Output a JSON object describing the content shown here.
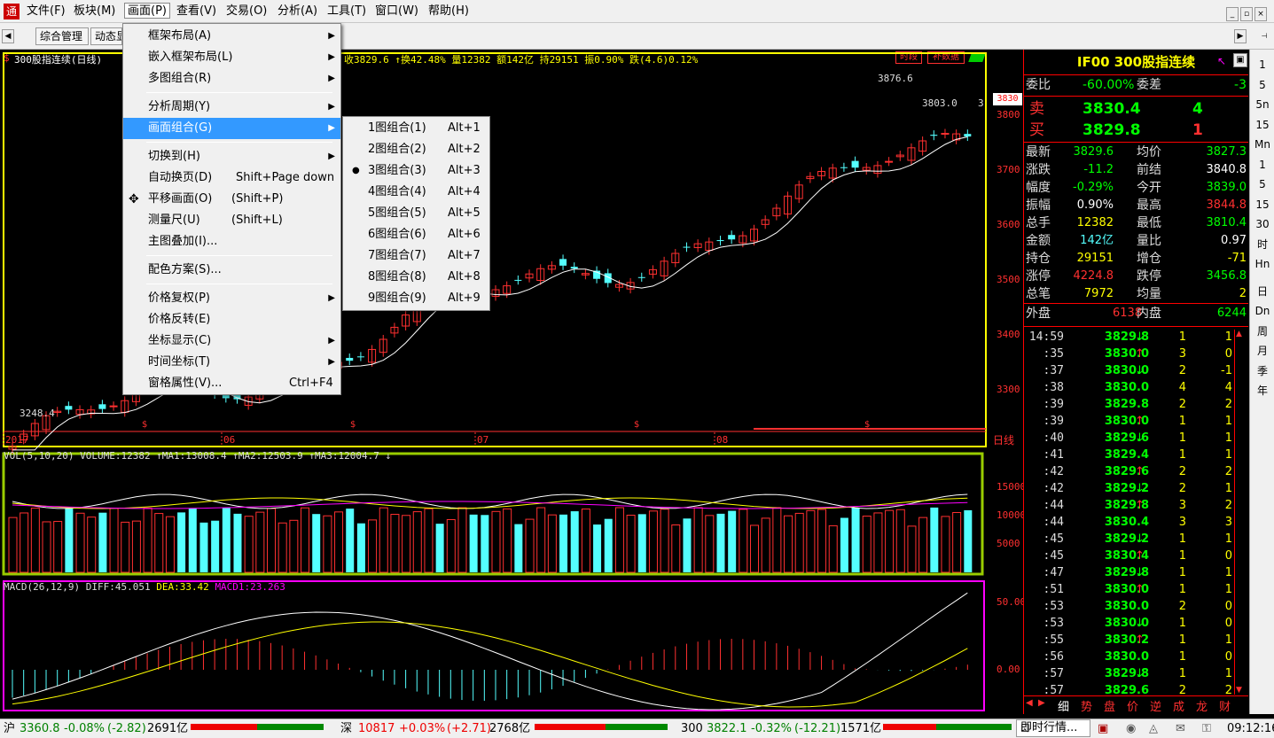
{
  "app": {
    "logo": "通",
    "colors": {
      "up": "#ff3030",
      "down": "#54ffff",
      "ma": "#ffff00",
      "bg": "#000000"
    }
  },
  "menubar": [
    "文件(F)",
    "板块(M)",
    "画面(P)",
    "查看(V)",
    "交易(O)",
    "分析(A)",
    "工具(T)",
    "窗口(W)",
    "帮助(H)"
  ],
  "window_controls": [
    "_",
    "▫",
    "×"
  ],
  "tabs": [
    "综合管理",
    "动态显"
  ],
  "chart_header": {
    "title": "300股指连续(日线)",
    "stats": "收3829.6 ↑换42.48% 量12382 额142亿 持29151 振0.90% 跌(4.6)0.12%"
  },
  "chart_buttons": [
    "时段",
    "补数据"
  ],
  "price_labels": {
    "high": "3876.6",
    "current": "3803.0",
    "low": "3248.4",
    "cur_tag": "3830",
    "suffix": "3"
  },
  "y_axis": {
    "price": [
      "3800",
      "3700",
      "3600",
      "3500",
      "3400",
      "3300"
    ],
    "volume": [
      "15000",
      "10000",
      "5000"
    ],
    "macd": [
      "50.00",
      "0.00"
    ]
  },
  "x_axis": {
    "labels": [
      "2017",
      "06",
      "07",
      "08"
    ],
    "period": "日线",
    "s_mark": "$"
  },
  "vol_header": "VOL(5,10,20) VOLUME:12382 ↑MA1:13008.4 ↑MA2:12503.9 ↑MA3:12004.7 ↓",
  "macd_header": {
    "name": "MACD(26,12,9)",
    "diff": "DIFF:45.051",
    "dea": "DEA:33.42",
    "macd": "MACD1:23.263"
  },
  "quote": {
    "title": "IF00  300股指连续",
    "weibi": {
      "label": "委比",
      "value": "-60.00%",
      "label2": "委差",
      "value2": "-3"
    },
    "sell": {
      "label": "卖",
      "price": "3830.4",
      "vol": "4"
    },
    "buy": {
      "label": "买",
      "price": "3829.8",
      "vol": "1"
    },
    "rows": [
      {
        "l1": "最新",
        "v1": "3829.6",
        "c1": "#00ff00",
        "l2": "均价",
        "v2": "3827.3",
        "c2": "#00ff00"
      },
      {
        "l1": "涨跌",
        "v1": "-11.2",
        "c1": "#00ff00",
        "l2": "前结",
        "v2": "3840.8",
        "c2": "#ffffff"
      },
      {
        "l1": "幅度",
        "v1": "-0.29%",
        "c1": "#00ff00",
        "l2": "今开",
        "v2": "3839.0",
        "c2": "#00ff00"
      },
      {
        "l1": "振幅",
        "v1": "0.90%",
        "c1": "#ffffff",
        "l2": "最高",
        "v2": "3844.8",
        "c2": "#ff3030"
      },
      {
        "l1": "总手",
        "v1": "12382",
        "c1": "#ffff00",
        "l2": "最低",
        "v2": "3810.4",
        "c2": "#00ff00"
      },
      {
        "l1": "金额",
        "v1": "142亿",
        "c1": "#54ffff",
        "l2": "量比",
        "v2": "0.97",
        "c2": "#ffffff"
      },
      {
        "l1": "持仓",
        "v1": "29151",
        "c1": "#ffff00",
        "l2": "增仓",
        "v2": "-71",
        "c2": "#ffff00"
      },
      {
        "l1": "涨停",
        "v1": "4224.8",
        "c1": "#ff3030",
        "l2": "跌停",
        "v2": "3456.8",
        "c2": "#00ff00"
      },
      {
        "l1": "总笔",
        "v1": "7972",
        "c1": "#ffff00",
        "l2": "均量",
        "v2": "2",
        "c2": "#ffff00"
      }
    ],
    "waipan": {
      "label": "外盘",
      "value": "6138",
      "label2": "内盘",
      "value2": "6244"
    }
  },
  "ticks": [
    {
      "t": "14:59",
      "p": "3829.8",
      "d": "↓",
      "v": "1",
      "o": "1"
    },
    {
      "t": ":35",
      "p": "3830.0",
      "d": "↑",
      "v": "3",
      "o": "0"
    },
    {
      "t": ":37",
      "p": "3830.0",
      "d": "↓",
      "v": "2",
      "o": "-1"
    },
    {
      "t": ":38",
      "p": "3830.0",
      "d": "",
      "v": "4",
      "o": "4"
    },
    {
      "t": ":39",
      "p": "3829.8",
      "d": "",
      "v": "2",
      "o": "2"
    },
    {
      "t": ":39",
      "p": "3830.0",
      "d": "↑",
      "v": "1",
      "o": "1"
    },
    {
      "t": ":40",
      "p": "3829.6",
      "d": "↓",
      "v": "1",
      "o": "1"
    },
    {
      "t": ":41",
      "p": "3829.4",
      "d": "",
      "v": "1",
      "o": "1"
    },
    {
      "t": ":42",
      "p": "3829.6",
      "d": "↑",
      "v": "2",
      "o": "2"
    },
    {
      "t": ":42",
      "p": "3829.2",
      "d": "↓",
      "v": "2",
      "o": "1"
    },
    {
      "t": ":44",
      "p": "3829.8",
      "d": "↑",
      "v": "3",
      "o": "2"
    },
    {
      "t": ":44",
      "p": "3830.4",
      "d": "",
      "v": "3",
      "o": "3"
    },
    {
      "t": ":45",
      "p": "3829.2",
      "d": "↓",
      "v": "1",
      "o": "1"
    },
    {
      "t": ":45",
      "p": "3830.4",
      "d": "↑",
      "v": "1",
      "o": "0"
    },
    {
      "t": ":47",
      "p": "3829.8",
      "d": "↓",
      "v": "1",
      "o": "1"
    },
    {
      "t": ":51",
      "p": "3830.0",
      "d": "↑",
      "v": "1",
      "o": "1"
    },
    {
      "t": ":53",
      "p": "3830.0",
      "d": "",
      "v": "2",
      "o": "0"
    },
    {
      "t": ":53",
      "p": "3830.0",
      "d": "↓",
      "v": "1",
      "o": "0"
    },
    {
      "t": ":55",
      "p": "3830.2",
      "d": "↑",
      "v": "1",
      "o": "1"
    },
    {
      "t": ":56",
      "p": "3830.0",
      "d": "",
      "v": "1",
      "o": "0"
    },
    {
      "t": ":57",
      "p": "3829.8",
      "d": "↓",
      "v": "1",
      "o": "1"
    },
    {
      "t": ":57",
      "p": "3829.6",
      "d": "",
      "v": "2",
      "o": "2"
    }
  ],
  "bottom_tabs": [
    "细",
    "势",
    "盘",
    "价",
    "逆",
    "成",
    "龙",
    "财"
  ],
  "vsidebar": [
    "1",
    "5",
    "5n",
    "15",
    "Mn",
    "1",
    "5",
    "15",
    "30",
    "时",
    "Hn",
    "日",
    "Dn",
    "周",
    "月",
    "季",
    "年"
  ],
  "statusbar": {
    "sh": {
      "name": "沪",
      "price": "3360.8",
      "pct": "-0.08%",
      "chg": "(-2.82)",
      "amt": "2691亿"
    },
    "sz": {
      "name": "深",
      "price": "10817",
      "pct": "+0.03%",
      "chg": "(+2.71)",
      "amt": "2768亿"
    },
    "hs": {
      "name": "300",
      "price": "3822.1",
      "pct": "-0.32%",
      "chg": "(-12.21)",
      "amt": "1571亿"
    },
    "news": "即时行情...",
    "time": "09:12:16"
  },
  "menu_huamian": [
    {
      "label": "框架布局(A)",
      "arrow": true
    },
    {
      "label": "嵌入框架布局(L)",
      "arrow": true
    },
    {
      "label": "多图组合(R)",
      "arrow": true
    },
    {
      "sep": true
    },
    {
      "label": "分析周期(Y)",
      "arrow": true
    },
    {
      "label": "画面组合(G)",
      "arrow": true,
      "hl": true
    },
    {
      "sep": true
    },
    {
      "label": "切换到(H)",
      "arrow": true
    },
    {
      "label": "自动换页(D)",
      "sc": "Shift+Page down"
    },
    {
      "label": "平移画面(O)",
      "sc": "(Shift+P)",
      "icon": "✥"
    },
    {
      "label": "测量尺(U)",
      "sc": "(Shift+L)"
    },
    {
      "label": "主图叠加(I)..."
    },
    {
      "sep": true
    },
    {
      "label": "配色方案(S)..."
    },
    {
      "sep": true
    },
    {
      "label": "价格复权(P)",
      "arrow": true
    },
    {
      "label": "价格反转(E)"
    },
    {
      "label": "坐标显示(C)",
      "arrow": true
    },
    {
      "label": "时间坐标(T)",
      "arrow": true
    },
    {
      "label": "窗格属性(V)...",
      "sc": "Ctrl+F4"
    }
  ],
  "menu_combo": [
    {
      "label": "1图组合(1)",
      "sc": "Alt+1"
    },
    {
      "label": "2图组合(2)",
      "sc": "Alt+2"
    },
    {
      "label": "3图组合(3)",
      "sc": "Alt+3",
      "checked": true
    },
    {
      "label": "4图组合(4)",
      "sc": "Alt+4"
    },
    {
      "label": "5图组合(5)",
      "sc": "Alt+5"
    },
    {
      "label": "6图组合(6)",
      "sc": "Alt+6"
    },
    {
      "label": "7图组合(7)",
      "sc": "Alt+7"
    },
    {
      "label": "8图组合(8)",
      "sc": "Alt+8"
    },
    {
      "label": "9图组合(9)",
      "sc": "Alt+9"
    }
  ]
}
